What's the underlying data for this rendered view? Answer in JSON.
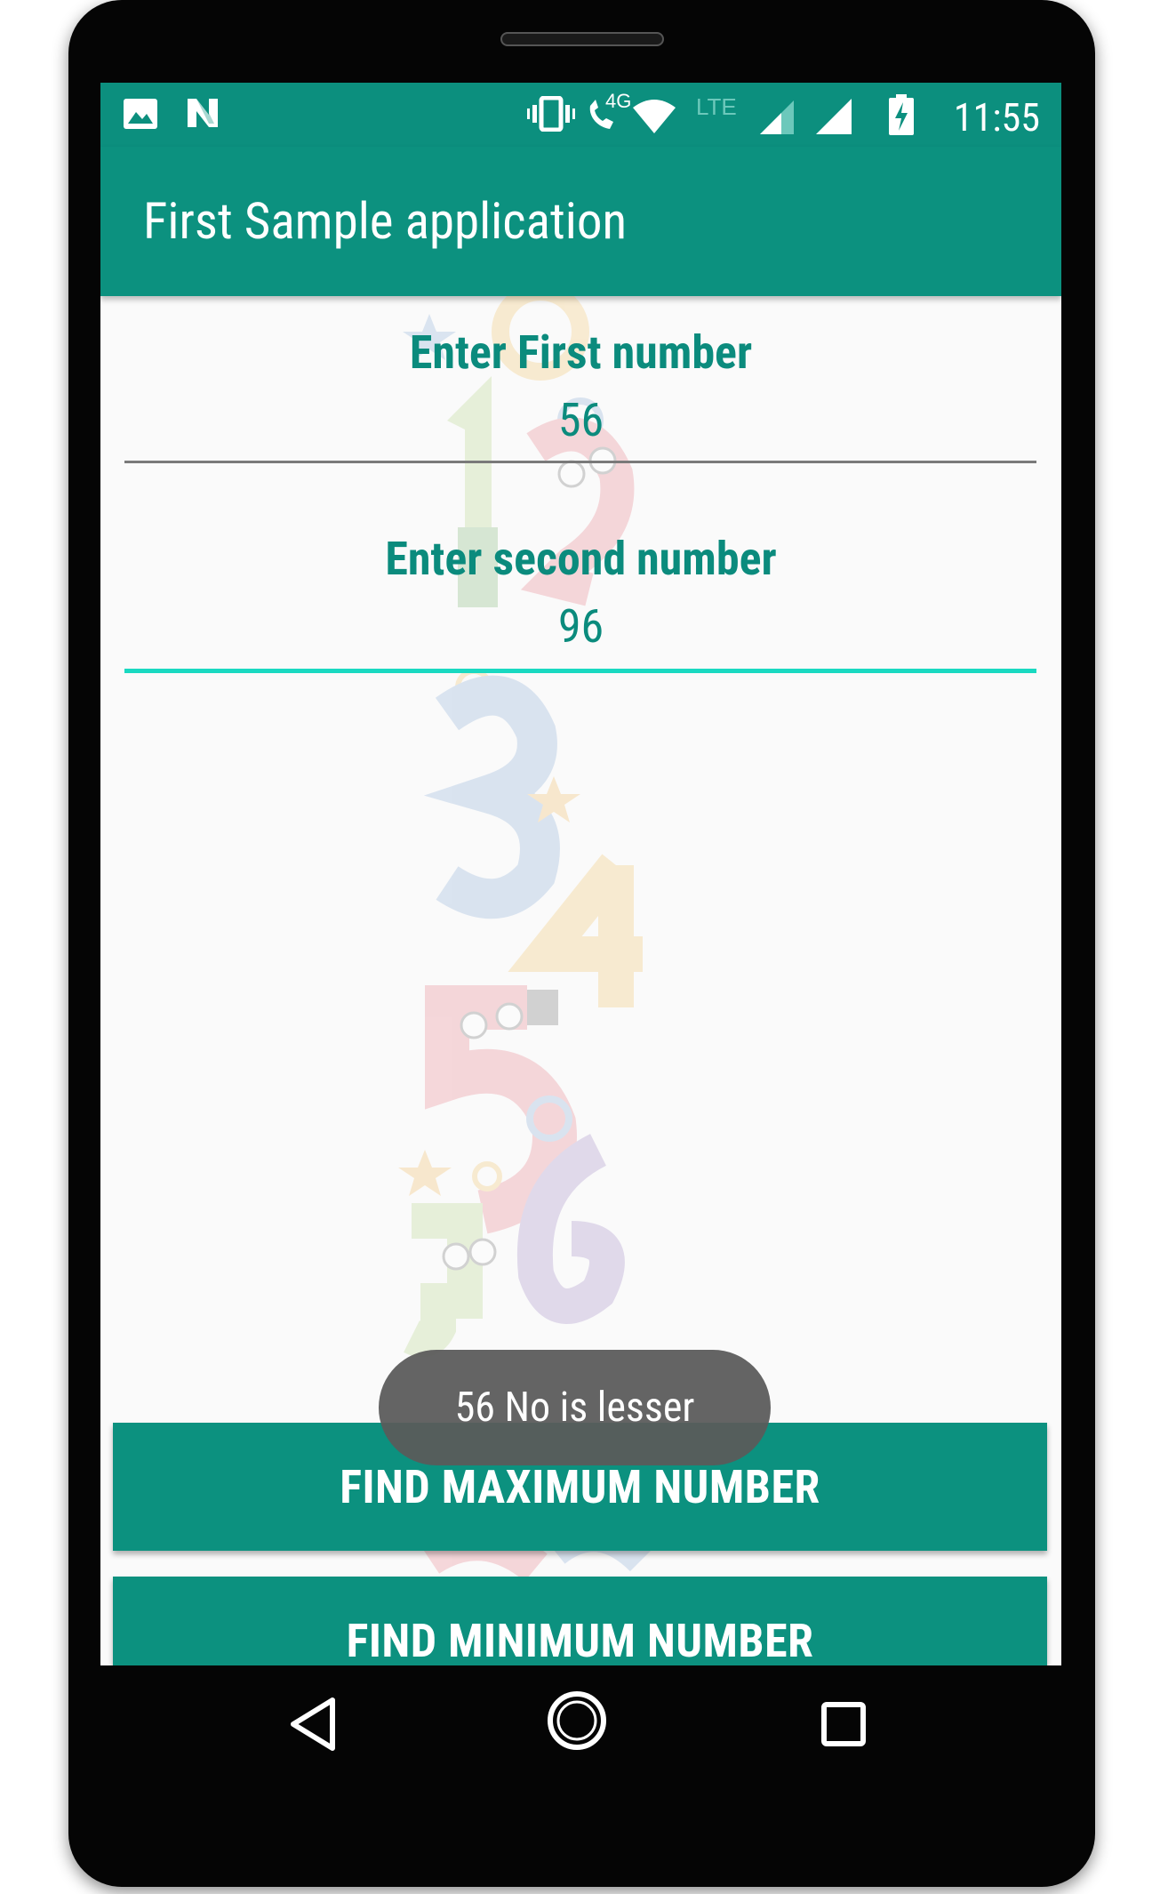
{
  "statusbar": {
    "network_4g": "4G",
    "network_lte": "LTE",
    "time": "11:55"
  },
  "app": {
    "title": "First Sample application"
  },
  "form": {
    "first_label": "Enter First number",
    "first_value": "56",
    "second_label": "Enter second number",
    "second_value": "96"
  },
  "buttons": {
    "max_label": "FIND MAXIMUM NUMBER",
    "min_label": "FIND MINIMUM NUMBER"
  },
  "toast": {
    "message": "56 No is lesser"
  },
  "colors": {
    "primary": "#0c917f",
    "accent": "#19d9c1",
    "text": "#0b8b7d"
  },
  "icons": [
    "image-icon",
    "n-notification-icon",
    "vibrate-icon",
    "wifi-calling-icon",
    "wifi-icon",
    "cell-signal-icon",
    "battery-charging-icon",
    "back-icon",
    "home-icon",
    "recents-icon"
  ]
}
